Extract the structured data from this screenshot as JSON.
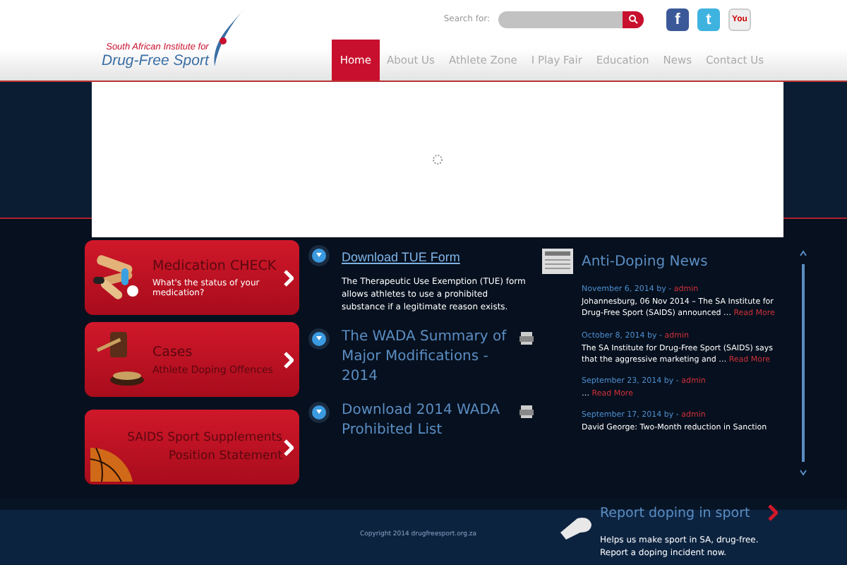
{
  "logo": {
    "line1": "South African Institute for",
    "line2": "Drug-Free Sport"
  },
  "search": {
    "label": "Search for:"
  },
  "social": [
    {
      "kind": "facebook",
      "glyph": "f"
    },
    {
      "kind": "twitter",
      "glyph": "t"
    },
    {
      "kind": "youtube",
      "glyph": "You"
    }
  ],
  "nav": [
    {
      "label": "Home",
      "selected": true
    },
    {
      "label": "About Us",
      "selected": false
    },
    {
      "label": "Athlete Zone",
      "selected": false
    },
    {
      "label": "I Play Fair",
      "selected": false
    },
    {
      "label": "Education",
      "selected": false
    },
    {
      "label": "News",
      "selected": false
    },
    {
      "label": "Contact Us",
      "selected": false
    }
  ],
  "cards": [
    {
      "kind": "pills",
      "title": "Medication CHECK",
      "subtitle": "What's the status of your medication?"
    },
    {
      "kind": "gavel",
      "title": "Cases",
      "subtitle": "Athlete Doping Offences"
    },
    {
      "kind": "ball",
      "title": "SAIDS Sport Supplements",
      "subtitle": "Position Statement"
    }
  ],
  "downloads": [
    {
      "kind": "link",
      "title": "Download TUE Form",
      "text": "The Therapeutic Use Exemption (TUE) form allows athletes to use a prohibited substance if a legitimate reason exists."
    },
    {
      "kind": "pdf",
      "title": "The WADA Summary of Major Modifications - 2014"
    },
    {
      "kind": "pdf",
      "title": "Download 2014 WADA Prohibited List"
    }
  ],
  "news": {
    "title": "Anti-Doping News",
    "items": [
      {
        "date": "November 6, 2014 by -",
        "author": "admin",
        "text": "Johannesburg, 06 Nov 2014 – The SA Institute for Drug-Free Sport (SAIDS) announced …",
        "more": "Read More"
      },
      {
        "date": "October 8, 2014 by -",
        "author": "admin",
        "text": "The SA Institute for Drug-Free Sport (SAIDS) says that the aggressive marketing and …",
        "more": "Read More"
      },
      {
        "date": "September 23, 2014 by -",
        "author": "admin",
        "text": "…",
        "more": "Read More"
      },
      {
        "date": "September 17, 2014 by -",
        "author": "admin",
        "text": "David George: Two-Month reduction in Sanction"
      }
    ]
  },
  "footer": {
    "copyright": "Copyright 2014 drugfreesport.org.za",
    "report_title": "Report doping in sport",
    "report_text": "Helps us make sport in SA, drug-free. Report a doping incident now."
  }
}
